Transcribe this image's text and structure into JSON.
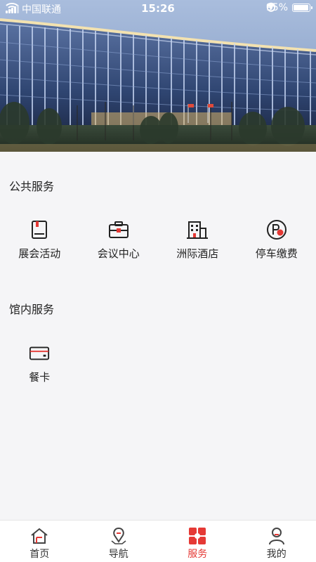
{
  "status_bar": {
    "carrier": "中国联通",
    "time": "15:26",
    "battery": "95%",
    "battery_level": 0.95
  },
  "hero": {
    "image": "hotel-building-photo"
  },
  "sections": {
    "public": {
      "title": "公共服务",
      "items": [
        {
          "label": "展会活动",
          "icon": "book-icon"
        },
        {
          "label": "会议中心",
          "icon": "briefcase-icon"
        },
        {
          "label": "洲际酒店",
          "icon": "hotel-icon"
        },
        {
          "label": "停车缴费",
          "icon": "parking-icon"
        }
      ]
    },
    "venue": {
      "title": "馆内服务",
      "items": [
        {
          "label": "餐卡",
          "icon": "card-icon"
        }
      ]
    }
  },
  "tabbar": {
    "tabs": [
      {
        "label": "首页",
        "icon": "home-icon",
        "active": false
      },
      {
        "label": "导航",
        "icon": "navigation-icon",
        "active": false
      },
      {
        "label": "服务",
        "icon": "services-icon",
        "active": true
      },
      {
        "label": "我的",
        "icon": "profile-icon",
        "active": false
      }
    ]
  },
  "colors": {
    "accent": "#e53935",
    "icon_dark": "#222222",
    "background": "#f5f5f7"
  }
}
